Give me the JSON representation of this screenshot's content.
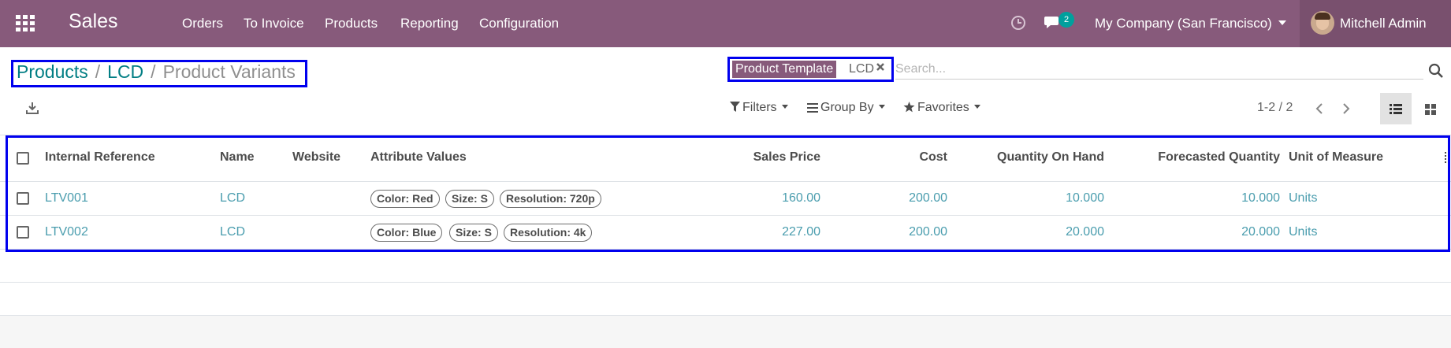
{
  "navbar": {
    "app_name": "Sales",
    "menu": [
      "Orders",
      "To Invoice",
      "Products",
      "Reporting",
      "Configuration"
    ],
    "chat_count": "2",
    "company": "My Company (San Francisco)",
    "user": "Mitchell Admin",
    "icons": [
      "apps-grid-icon",
      "clock-icon",
      "chat-icon"
    ]
  },
  "breadcrumb": {
    "items": [
      "Products",
      "LCD"
    ],
    "separator": "/",
    "current": "Product Variants"
  },
  "search": {
    "facet_label": "Product Template",
    "facet_value": "LCD",
    "placeholder": "Search..."
  },
  "toolbar": {
    "filters": "Filters",
    "group_by": "Group By",
    "favorites": "Favorites",
    "pager": "1-2 / 2"
  },
  "table": {
    "columns": [
      "Internal Reference",
      "Name",
      "Website",
      "Attribute Values",
      "Sales Price",
      "Cost",
      "Quantity On Hand",
      "Forecasted Quantity",
      "Unit of Measure"
    ],
    "rows": [
      {
        "ref": "LTV001",
        "name": "LCD",
        "website": "",
        "attrs": [
          "Color: Red",
          "Size: S",
          "Resolution: 720p"
        ],
        "price": "160.00",
        "cost": "200.00",
        "qty": "10.000",
        "forecast": "10.000",
        "uom": "Units"
      },
      {
        "ref": "LTV002",
        "name": "LCD",
        "website": "",
        "attrs": [
          "Color: Blue",
          "Size: S",
          "Resolution: 4k"
        ],
        "price": "227.00",
        "cost": "200.00",
        "qty": "20.000",
        "forecast": "20.000",
        "uom": "Units"
      }
    ]
  },
  "colors": {
    "navbar": "#875a7b",
    "link": "#017e84",
    "cell_link": "#4a9dae",
    "highlight_box": "#0000ee"
  }
}
